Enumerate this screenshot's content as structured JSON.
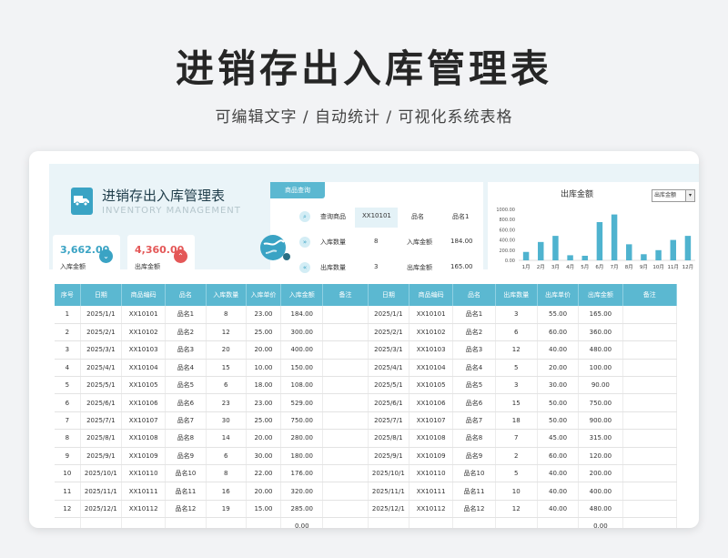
{
  "page": {
    "title": "进销存出入库管理表",
    "subtitle": "可编辑文字 / 自动统计 / 可视化系统表格"
  },
  "dashboard": {
    "title": "进销存出入库管理表",
    "subtitle": "INVENTORY MANAGEMENT",
    "in_amount": {
      "value": "3,662.00",
      "label": "入库金额",
      "color": "#3aa3c4"
    },
    "out_amount": {
      "value": "4,360.00",
      "label": "出库金额",
      "color": "#e45858"
    },
    "query": {
      "tab": "商品查询",
      "rows": [
        {
          "label": "查询商品",
          "value": "XX10101",
          "label2": "品名",
          "value2": "品名1"
        },
        {
          "label": "入库数量",
          "value": "8",
          "label2": "入库金额",
          "value2": "184.00"
        },
        {
          "label": "出库数量",
          "value": "3",
          "label2": "出库金额",
          "value2": "165.00"
        }
      ]
    },
    "chart_select": "出库金额"
  },
  "chart_data": {
    "type": "bar",
    "title": "出库金额",
    "categories": [
      "1月",
      "2月",
      "3月",
      "4月",
      "5月",
      "6月",
      "7月",
      "8月",
      "9月",
      "10月",
      "11月",
      "12月"
    ],
    "values": [
      165,
      360,
      480,
      100,
      90,
      750,
      900,
      315,
      120,
      200,
      400,
      480
    ],
    "ylim": [
      0,
      1000
    ],
    "yticks": [
      "0.00",
      "200.00",
      "400.00",
      "600.00",
      "800.00",
      "1000.00"
    ],
    "color": "#4fb3cf"
  },
  "table": {
    "headers": [
      "序号",
      "日期",
      "商品编码",
      "品名",
      "入库数量",
      "入库单价",
      "入库金额",
      "备注",
      "日期",
      "商品编码",
      "品名",
      "出库数量",
      "出库单价",
      "出库金额",
      "备注"
    ],
    "rows": [
      [
        "1",
        "2025/1/1",
        "XX10101",
        "品名1",
        "8",
        "23.00",
        "184.00",
        "",
        "2025/1/1",
        "XX10101",
        "品名1",
        "3",
        "55.00",
        "165.00",
        ""
      ],
      [
        "2",
        "2025/2/1",
        "XX10102",
        "品名2",
        "12",
        "25.00",
        "300.00",
        "",
        "2025/2/1",
        "XX10102",
        "品名2",
        "6",
        "60.00",
        "360.00",
        ""
      ],
      [
        "3",
        "2025/3/1",
        "XX10103",
        "品名3",
        "20",
        "20.00",
        "400.00",
        "",
        "2025/3/1",
        "XX10103",
        "品名3",
        "12",
        "40.00",
        "480.00",
        ""
      ],
      [
        "4",
        "2025/4/1",
        "XX10104",
        "品名4",
        "15",
        "10.00",
        "150.00",
        "",
        "2025/4/1",
        "XX10104",
        "品名4",
        "5",
        "20.00",
        "100.00",
        ""
      ],
      [
        "5",
        "2025/5/1",
        "XX10105",
        "品名5",
        "6",
        "18.00",
        "108.00",
        "",
        "2025/5/1",
        "XX10105",
        "品名5",
        "3",
        "30.00",
        "90.00",
        ""
      ],
      [
        "6",
        "2025/6/1",
        "XX10106",
        "品名6",
        "23",
        "23.00",
        "529.00",
        "",
        "2025/6/1",
        "XX10106",
        "品名6",
        "15",
        "50.00",
        "750.00",
        ""
      ],
      [
        "7",
        "2025/7/1",
        "XX10107",
        "品名7",
        "30",
        "25.00",
        "750.00",
        "",
        "2025/7/1",
        "XX10107",
        "品名7",
        "18",
        "50.00",
        "900.00",
        ""
      ],
      [
        "8",
        "2025/8/1",
        "XX10108",
        "品名8",
        "14",
        "20.00",
        "280.00",
        "",
        "2025/8/1",
        "XX10108",
        "品名8",
        "7",
        "45.00",
        "315.00",
        ""
      ],
      [
        "9",
        "2025/9/1",
        "XX10109",
        "品名9",
        "6",
        "30.00",
        "180.00",
        "",
        "2025/9/1",
        "XX10109",
        "品名9",
        "2",
        "60.00",
        "120.00",
        ""
      ],
      [
        "10",
        "2025/10/1",
        "XX10110",
        "品名10",
        "8",
        "22.00",
        "176.00",
        "",
        "2025/10/1",
        "XX10110",
        "品名10",
        "5",
        "40.00",
        "200.00",
        ""
      ],
      [
        "11",
        "2025/11/1",
        "XX10111",
        "品名11",
        "16",
        "20.00",
        "320.00",
        "",
        "2025/11/1",
        "XX10111",
        "品名11",
        "10",
        "40.00",
        "400.00",
        ""
      ],
      [
        "12",
        "2025/12/1",
        "XX10112",
        "品名12",
        "19",
        "15.00",
        "285.00",
        "",
        "2025/12/1",
        "XX10112",
        "品名12",
        "12",
        "40.00",
        "480.00",
        ""
      ],
      [
        "",
        "",
        "",
        "",
        "",
        "",
        "0.00",
        "",
        "",
        "",
        "",
        "",
        "",
        "0.00",
        ""
      ]
    ]
  }
}
